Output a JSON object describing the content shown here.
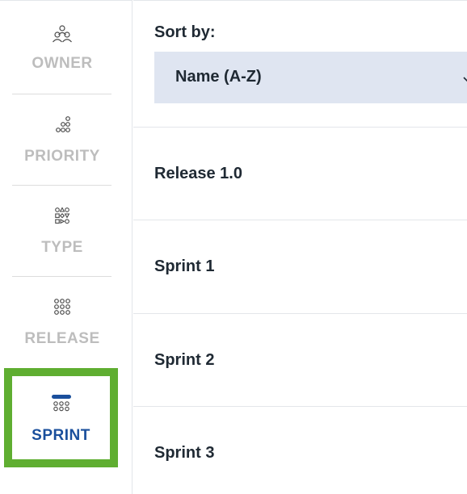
{
  "sidebar": {
    "items": [
      {
        "id": "owner",
        "label": "OWNER",
        "icon": "people-icon",
        "active": false
      },
      {
        "id": "priority",
        "label": "PRIORITY",
        "icon": "priority-dots-icon",
        "active": false
      },
      {
        "id": "type",
        "label": "TYPE",
        "icon": "shapes-icon",
        "active": false
      },
      {
        "id": "release",
        "label": "RELEASE",
        "icon": "dot-grid-icon",
        "active": false
      },
      {
        "id": "sprint",
        "label": "SPRINT",
        "icon": "sprint-icon",
        "active": true
      }
    ]
  },
  "main": {
    "sort_label": "Sort by:",
    "sort_value": "Name (A-Z)",
    "rows": [
      {
        "name": "Release 1.0"
      },
      {
        "name": "Sprint 1"
      },
      {
        "name": "Sprint 2"
      },
      {
        "name": "Sprint 3"
      }
    ]
  },
  "colors": {
    "active_highlight": "#5fae31",
    "active_label": "#1a4f9c",
    "inactive_label": "#bdbdbd",
    "select_bg": "#dfe5f1",
    "text": "#1f2933"
  }
}
